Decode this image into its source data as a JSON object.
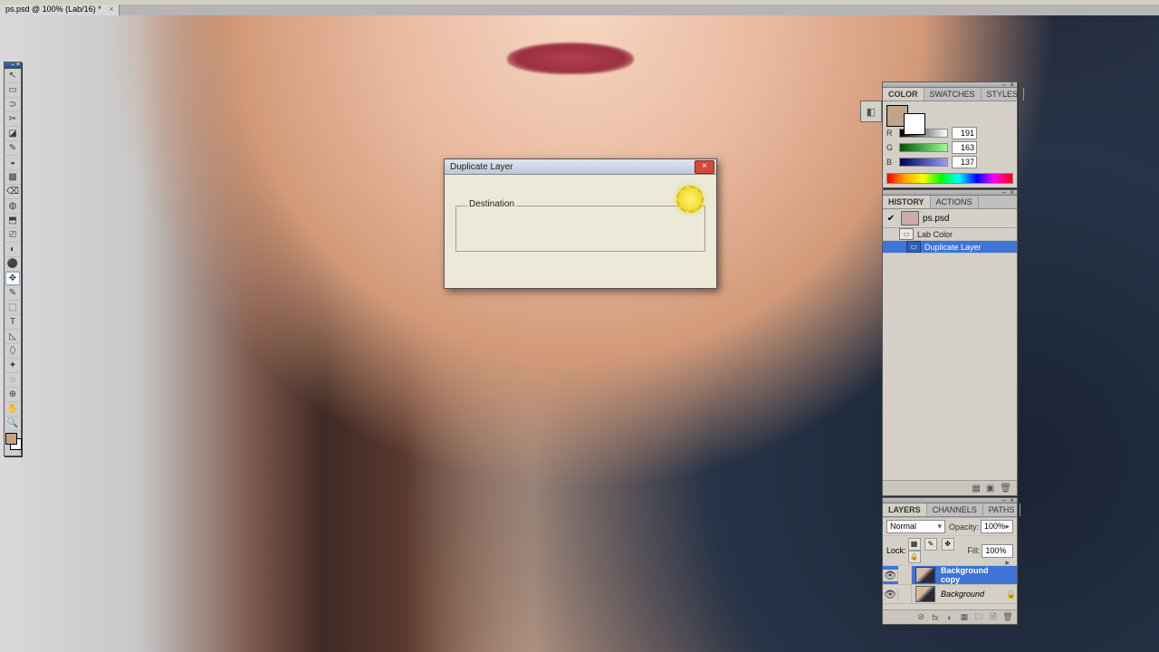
{
  "doc_tab": {
    "label": "ps.psd @ 100% (Lab/16) *",
    "close": "×"
  },
  "toolbox": {
    "tools": [
      "↖",
      "▭",
      "⊃",
      "✂",
      "◪",
      "✎",
      "◒",
      "▩",
      "⌫",
      "◍",
      "⬒",
      "⎚",
      "◐",
      "⚫",
      "✥",
      "✎",
      "⬚",
      "T",
      "◺",
      "⬯",
      "✦",
      "◌",
      "⊕",
      "✋",
      "🔍"
    ],
    "selected_index": 14
  },
  "dialog": {
    "title": "Duplicate Layer",
    "fieldset": "Destination",
    "close": "×"
  },
  "color_panel": {
    "tabs": [
      "COLOR",
      "SWATCHES",
      "STYLES"
    ],
    "r": {
      "label": "R",
      "value": "191"
    },
    "g": {
      "label": "G",
      "value": "163"
    },
    "b": {
      "label": "B",
      "value": "137"
    }
  },
  "history_panel": {
    "tabs": [
      "HISTORY",
      "ACTIONS"
    ],
    "snapshot": "ps.psd",
    "items": [
      {
        "label": "Lab Color",
        "selected": false
      },
      {
        "label": "Duplicate Layer",
        "selected": true
      }
    ],
    "footer": [
      "▦",
      "▣",
      "🗑"
    ]
  },
  "layers_panel": {
    "tabs": [
      "LAYERS",
      "CHANNELS",
      "PATHS"
    ],
    "mode": "Normal",
    "opacity_label": "Opacity:",
    "opacity_value": "100%",
    "lock_label": "Lock:",
    "fill_label": "Fill:",
    "fill_value": "100%",
    "layers": [
      {
        "name": "Background copy",
        "selected": true,
        "locked": false,
        "italic": false
      },
      {
        "name": "Background",
        "selected": false,
        "locked": true,
        "italic": true
      }
    ],
    "footer": [
      "⊘",
      "fx",
      "◐",
      "▦",
      "🗀",
      "🗎",
      "🗑"
    ]
  },
  "collapse_icon": "◧"
}
